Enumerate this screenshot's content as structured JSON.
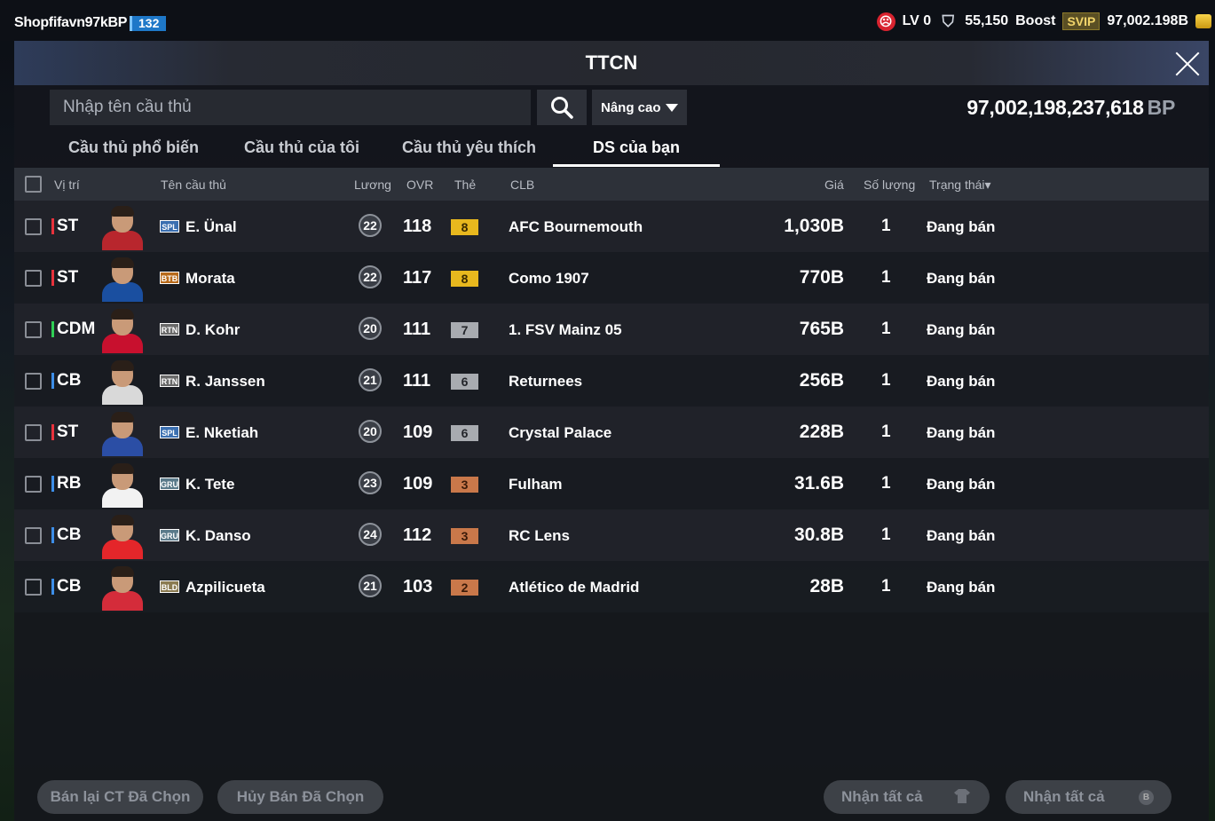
{
  "topbar": {
    "username": "Shopfifavn97kBP",
    "level": "132",
    "lv_label": "LV 0",
    "points": "55,150",
    "boost_label": "Boost",
    "svip_label": "SVIP",
    "balance": "97,002.198B"
  },
  "window": {
    "title": "TTCN"
  },
  "search": {
    "placeholder": "Nhập tên cầu thủ",
    "advanced_label": "Nâng cao"
  },
  "bp": {
    "amount": "97,002,198,237,618",
    "unit": "BP"
  },
  "tabs": [
    {
      "label": "Cầu thủ phổ biến",
      "active": false
    },
    {
      "label": "Cầu thủ của tôi",
      "active": false
    },
    {
      "label": "Cầu thủ yêu thích",
      "active": false
    },
    {
      "label": "DS của bạn",
      "active": true
    }
  ],
  "table": {
    "headers": {
      "position": "Vị trí",
      "name": "Tên cầu thủ",
      "salary": "Lương",
      "ovr": "OVR",
      "card": "Thẻ",
      "club": "CLB",
      "price": "Giá",
      "quantity": "Số lượng",
      "status": "Trạng thái▾"
    },
    "rows": [
      {
        "position": "ST",
        "pos_group": "atk",
        "season": "SPL",
        "name": "E. Ünal",
        "salary": "22",
        "ovr": "118",
        "grade": "8",
        "grade_tier": "gold",
        "club": "AFC Bournemouth",
        "price": "1,030B",
        "quantity": "1",
        "status": "Đang bán"
      },
      {
        "position": "ST",
        "pos_group": "atk",
        "season": "BTB",
        "name": "Morata",
        "salary": "22",
        "ovr": "117",
        "grade": "8",
        "grade_tier": "gold",
        "club": "Como 1907",
        "price": "770B",
        "quantity": "1",
        "status": "Đang bán"
      },
      {
        "position": "CDM",
        "pos_group": "mid",
        "season": "RTN",
        "name": "D. Kohr",
        "salary": "20",
        "ovr": "111",
        "grade": "7",
        "grade_tier": "silver",
        "club": "1. FSV Mainz 05",
        "price": "765B",
        "quantity": "1",
        "status": "Đang bán"
      },
      {
        "position": "CB",
        "pos_group": "def",
        "season": "RTN",
        "name": "R. Janssen",
        "salary": "21",
        "ovr": "111",
        "grade": "6",
        "grade_tier": "silver",
        "club": "Returnees",
        "price": "256B",
        "quantity": "1",
        "status": "Đang bán"
      },
      {
        "position": "ST",
        "pos_group": "atk",
        "season": "SPL",
        "name": "E. Nketiah",
        "salary": "20",
        "ovr": "109",
        "grade": "6",
        "grade_tier": "silver",
        "club": "Crystal Palace",
        "price": "228B",
        "quantity": "1",
        "status": "Đang bán"
      },
      {
        "position": "RB",
        "pos_group": "def",
        "season": "GRU",
        "name": "K. Tete",
        "salary": "23",
        "ovr": "109",
        "grade": "3",
        "grade_tier": "bronze",
        "club": "Fulham",
        "price": "31.6B",
        "quantity": "1",
        "status": "Đang bán"
      },
      {
        "position": "CB",
        "pos_group": "def",
        "season": "GRU",
        "name": "K. Danso",
        "salary": "24",
        "ovr": "112",
        "grade": "3",
        "grade_tier": "bronze",
        "club": "RC Lens",
        "price": "30.8B",
        "quantity": "1",
        "status": "Đang bán"
      },
      {
        "position": "CB",
        "pos_group": "def",
        "season": "BLD",
        "name": "Azpilicueta",
        "salary": "21",
        "ovr": "103",
        "grade": "2",
        "grade_tier": "bronze",
        "club": "Atlético de Madrid",
        "price": "28B",
        "quantity": "1",
        "status": "Đang bán"
      }
    ]
  },
  "colors": {
    "attacker": "#e8323c",
    "midfielder": "#2fcf54",
    "defender": "#3d8ee8",
    "level_badge": "#1e78c8"
  },
  "shirt_colors": [
    "#b8262d",
    "#1a4fa0",
    "#c8102e",
    "#d9d9d9",
    "#2b4ea5",
    "#f2f2f2",
    "#e4262a",
    "#d42c3a"
  ],
  "season_colors": {
    "SPL": "#3b6fb0",
    "BTB": "#b86a1a",
    "RTN": "#6a6a6a",
    "GRU": "#5a7a8a",
    "BLD": "#8a7a50"
  },
  "actions": {
    "resell_label": "Bán lại CT Đã Chọn",
    "cancel_label": "Hủy Bán Đã Chọn",
    "claim_all_1": "Nhận tất cả",
    "claim_all_2": "Nhận tất cả"
  }
}
